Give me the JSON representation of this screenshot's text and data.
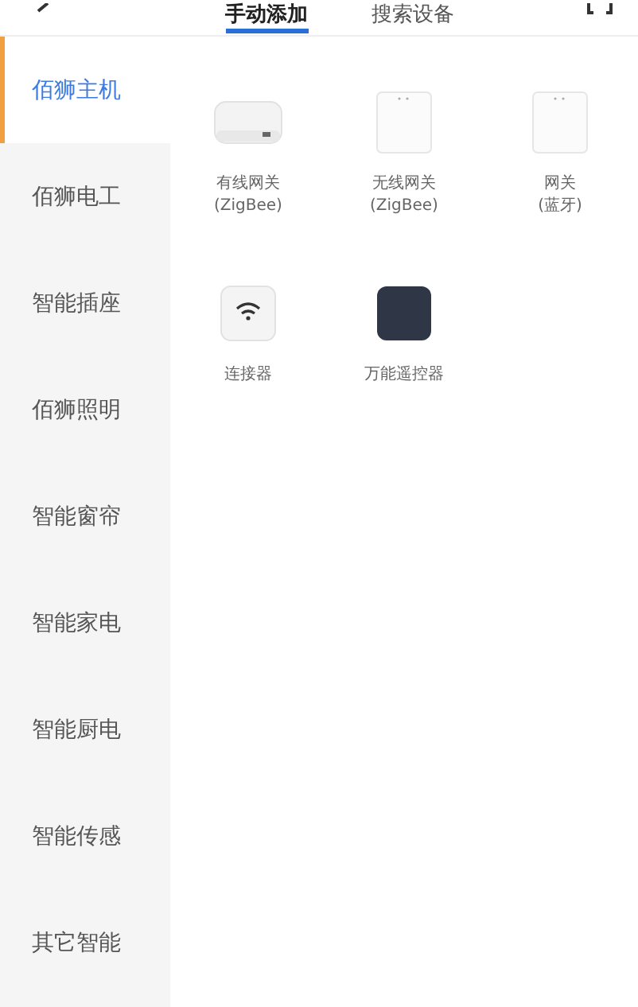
{
  "header": {
    "tabs": [
      {
        "label": "手动添加",
        "selected": true
      },
      {
        "label": "搜索设备",
        "selected": false
      }
    ]
  },
  "sidebar": {
    "items": [
      {
        "label": "佰狮主机",
        "selected": true
      },
      {
        "label": "佰狮电工",
        "selected": false
      },
      {
        "label": "智能插座",
        "selected": false
      },
      {
        "label": "佰狮照明",
        "selected": false
      },
      {
        "label": "智能窗帘",
        "selected": false
      },
      {
        "label": "智能家电",
        "selected": false
      },
      {
        "label": "智能厨电",
        "selected": false
      },
      {
        "label": "智能传感",
        "selected": false
      },
      {
        "label": "其它智能",
        "selected": false
      }
    ]
  },
  "devices": [
    {
      "kind": "hub",
      "name": "有线网关",
      "sub": "(ZigBee)"
    },
    {
      "kind": "tower",
      "name": "无线网关",
      "sub": "(ZigBee)"
    },
    {
      "kind": "tower",
      "name": "网关",
      "sub": "(蓝牙)"
    },
    {
      "kind": "wifi",
      "name": "连接器"
    },
    {
      "kind": "remote",
      "name": "万能遥控器"
    }
  ]
}
